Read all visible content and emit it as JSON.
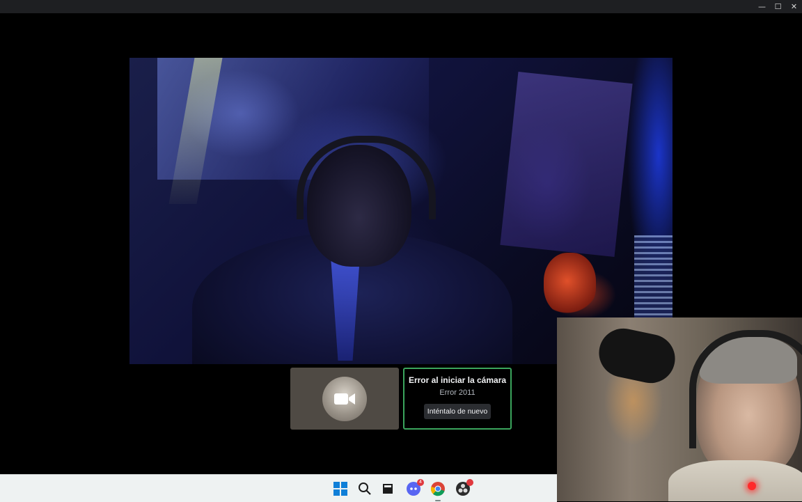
{
  "window": {
    "controls": {
      "minimize": "—",
      "maximize": "☐",
      "close": "✕"
    }
  },
  "call": {
    "camera_tile": {
      "icon": "video-camera-icon"
    },
    "error_tile": {
      "title": "Error al iniciar la cámara",
      "code": "Error 2011",
      "retry_button": "Inténtalo de nuevo",
      "border_color": "#3ba55d"
    }
  },
  "taskbar": {
    "items": [
      {
        "name": "start-icon"
      },
      {
        "name": "search-icon"
      },
      {
        "name": "task-view-icon"
      },
      {
        "name": "discord-icon",
        "badge": "4"
      },
      {
        "name": "chrome-icon",
        "running": true
      },
      {
        "name": "obs-icon",
        "badge": ""
      }
    ]
  },
  "colors": {
    "accent_green": "#3ba55d",
    "badge_red": "#e0393e",
    "taskbar_bg": "#eef2f2"
  }
}
